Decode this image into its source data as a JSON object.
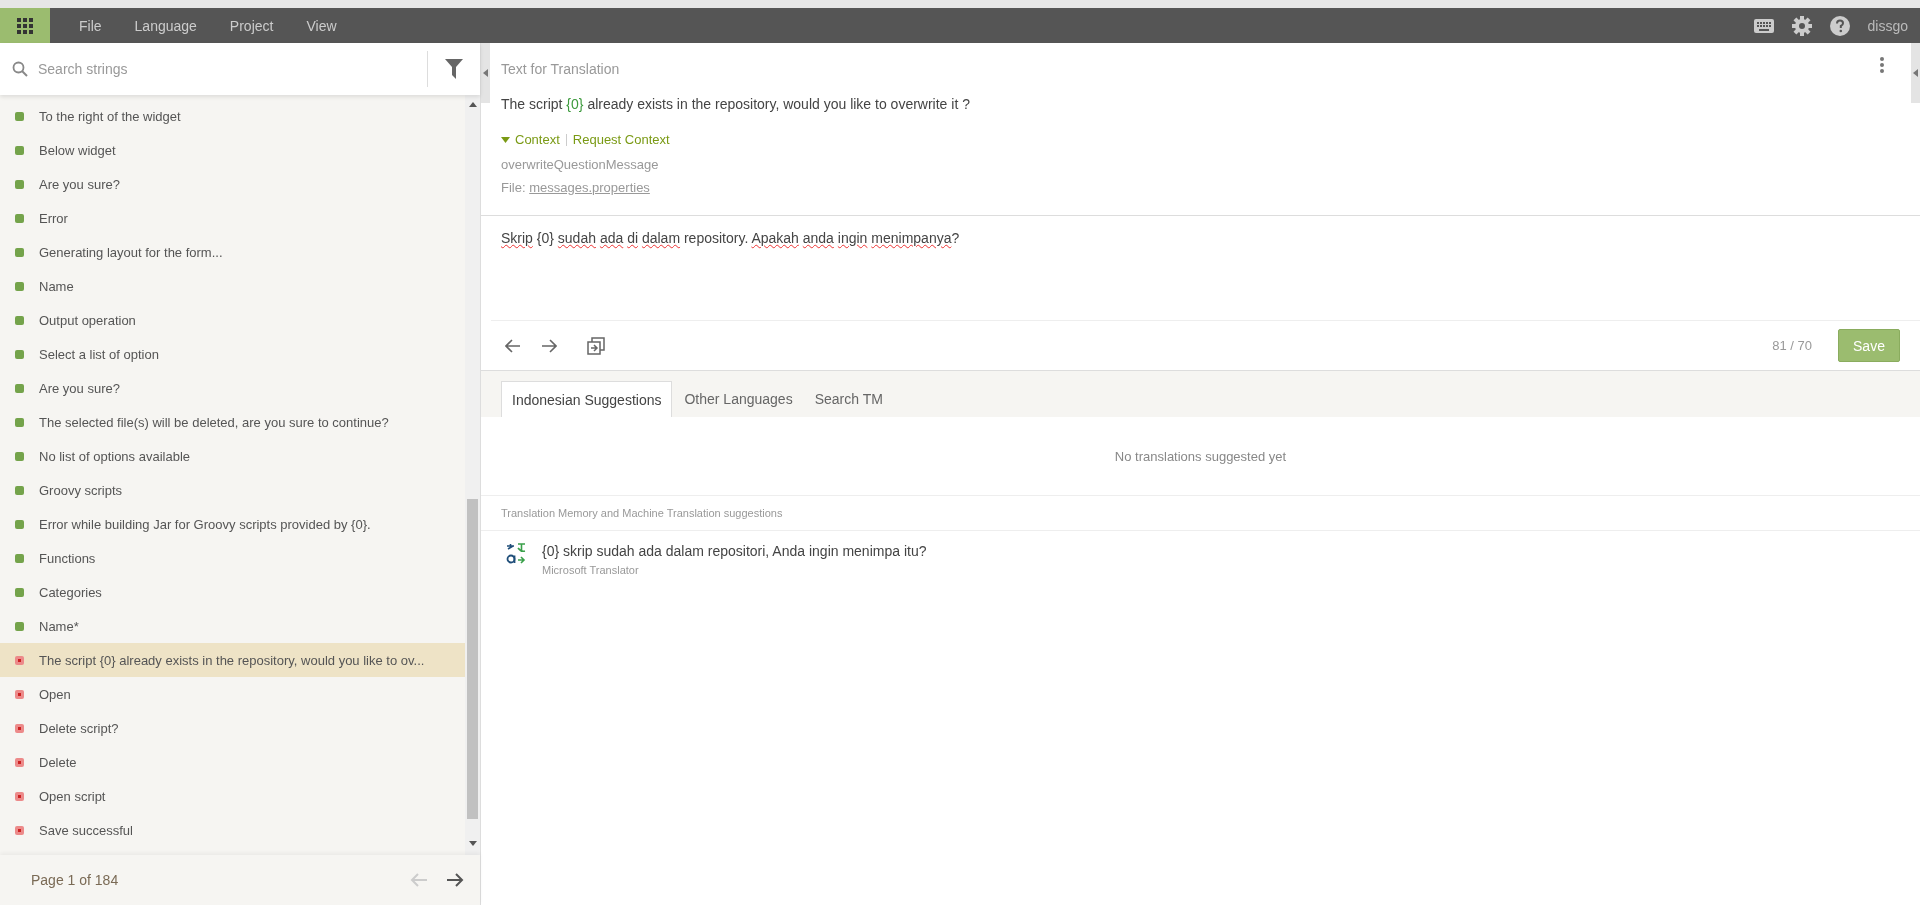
{
  "menu": {
    "items": [
      "File",
      "Language",
      "Project",
      "View"
    ],
    "user": "dissgo"
  },
  "sidebar": {
    "search": {
      "placeholder": "Search strings"
    },
    "items": [
      {
        "text": "To the right of the widget",
        "translated": true,
        "selected": false
      },
      {
        "text": "Below widget",
        "translated": true,
        "selected": false
      },
      {
        "text": "Are you sure?",
        "translated": true,
        "selected": false
      },
      {
        "text": "Error",
        "translated": true,
        "selected": false
      },
      {
        "text": "Generating layout for the form...",
        "translated": true,
        "selected": false
      },
      {
        "text": "Name",
        "translated": true,
        "selected": false
      },
      {
        "text": "Output operation",
        "translated": true,
        "selected": false
      },
      {
        "text": "Select a list of option",
        "translated": true,
        "selected": false
      },
      {
        "text": "Are you sure?",
        "translated": true,
        "selected": false
      },
      {
        "text": "The selected file(s) will be deleted, are you sure to continue?",
        "translated": true,
        "selected": false
      },
      {
        "text": "No list of options available",
        "translated": true,
        "selected": false
      },
      {
        "text": "Groovy scripts",
        "translated": true,
        "selected": false
      },
      {
        "text": "Error while building Jar for Groovy scripts provided by {0}.",
        "translated": true,
        "selected": false
      },
      {
        "text": "Functions",
        "translated": true,
        "selected": false
      },
      {
        "text": "Categories",
        "translated": true,
        "selected": false
      },
      {
        "text": "Name*",
        "translated": true,
        "selected": false
      },
      {
        "text": "The script {0} already exists in the repository, would you like to ov...",
        "translated": false,
        "selected": true
      },
      {
        "text": "Open",
        "translated": false,
        "selected": false
      },
      {
        "text": "Delete script?",
        "translated": false,
        "selected": false
      },
      {
        "text": "Delete",
        "translated": false,
        "selected": false
      },
      {
        "text": "Open script",
        "translated": false,
        "selected": false
      },
      {
        "text": "Save successful",
        "translated": false,
        "selected": false
      }
    ],
    "pager": "Page 1 of 184"
  },
  "source": {
    "heading": "Text for Translation",
    "segments": [
      {
        "text": "The script ",
        "kind": "plain"
      },
      {
        "text": "{0}",
        "kind": "placeholder"
      },
      {
        "text": " already exists in the repository, would you like to overwrite it ?",
        "kind": "plain"
      }
    ],
    "context_toggle": "Context",
    "expanded": true,
    "request_context": "Request Context",
    "key": "overwriteQuestionMessage",
    "file_label": "File:",
    "file_link": "messages.properties"
  },
  "translation": {
    "segments": [
      {
        "text": "Skrip",
        "kind": "misspelled"
      },
      {
        "text": " {0} ",
        "kind": "plain"
      },
      {
        "text": "sudah ada di dalam",
        "kind": "misspelled"
      },
      {
        "text": " repository. ",
        "kind": "plain"
      },
      {
        "text": "Apakah anda ingin menimpanya",
        "kind": "misspelled"
      },
      {
        "text": "?",
        "kind": "plain"
      }
    ],
    "count": "81 / 70",
    "save": "Save"
  },
  "tabs": [
    {
      "label": "Indonesian Suggestions",
      "selected": true
    },
    {
      "label": "Other Languages",
      "selected": false
    },
    {
      "label": "Search TM",
      "selected": false
    }
  ],
  "suggestions": {
    "empty": "No translations suggested yet",
    "tm_heading": "Translation Memory and Machine Translation suggestions",
    "items": [
      {
        "text": "{0} skrip sudah ada dalam repositori, Anda ingin menimpa itu?",
        "origin": "Microsoft Translator"
      }
    ]
  }
}
